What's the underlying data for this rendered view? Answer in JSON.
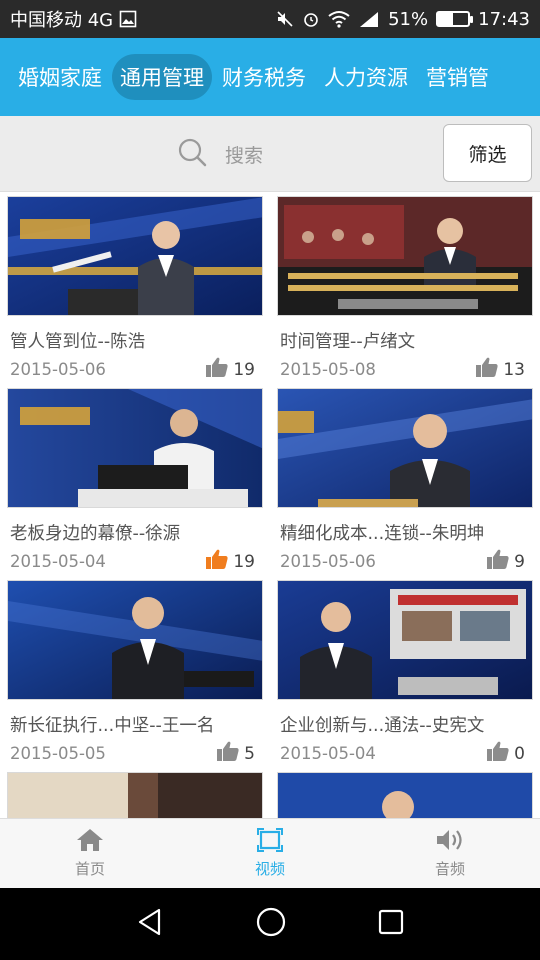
{
  "status_bar": {
    "carrier": "中国移动 4G",
    "battery": "51%",
    "battery_level": 0.51,
    "time": "17:43"
  },
  "tabs": [
    {
      "label": "婚姻家庭",
      "active": false
    },
    {
      "label": "通用管理",
      "active": true
    },
    {
      "label": "财务税务",
      "active": false
    },
    {
      "label": "人力资源",
      "active": false
    },
    {
      "label": "营销管",
      "active": false
    }
  ],
  "search": {
    "placeholder": "搜索",
    "filter_label": "筛选"
  },
  "videos": [
    {
      "title": "管人管到位--陈浩",
      "date": "2015-05-06",
      "likes": "19",
      "liked": false
    },
    {
      "title": "时间管理--卢绪文",
      "date": "2015-05-08",
      "likes": "13",
      "liked": false
    },
    {
      "title": "老板身边的幕僚--徐源",
      "date": "2015-05-04",
      "likes": "19",
      "liked": true
    },
    {
      "title": "精细化成本...连锁--朱明坤",
      "date": "2015-05-06",
      "likes": "9",
      "liked": false
    },
    {
      "title": "新长征执行...中坚--王一名",
      "date": "2015-05-05",
      "likes": "5",
      "liked": false
    },
    {
      "title": "企业创新与...通法--史宪文",
      "date": "2015-05-04",
      "likes": "0",
      "liked": false
    }
  ],
  "bottom_nav": [
    {
      "label": "首页",
      "icon": "home-icon",
      "active": false
    },
    {
      "label": "视频",
      "icon": "video-icon",
      "active": true
    },
    {
      "label": "音频",
      "icon": "audio-icon",
      "active": false
    }
  ],
  "colors": {
    "accent": "#29aee6",
    "liked": "#f07d1e",
    "unliked": "#8c8c8c"
  }
}
